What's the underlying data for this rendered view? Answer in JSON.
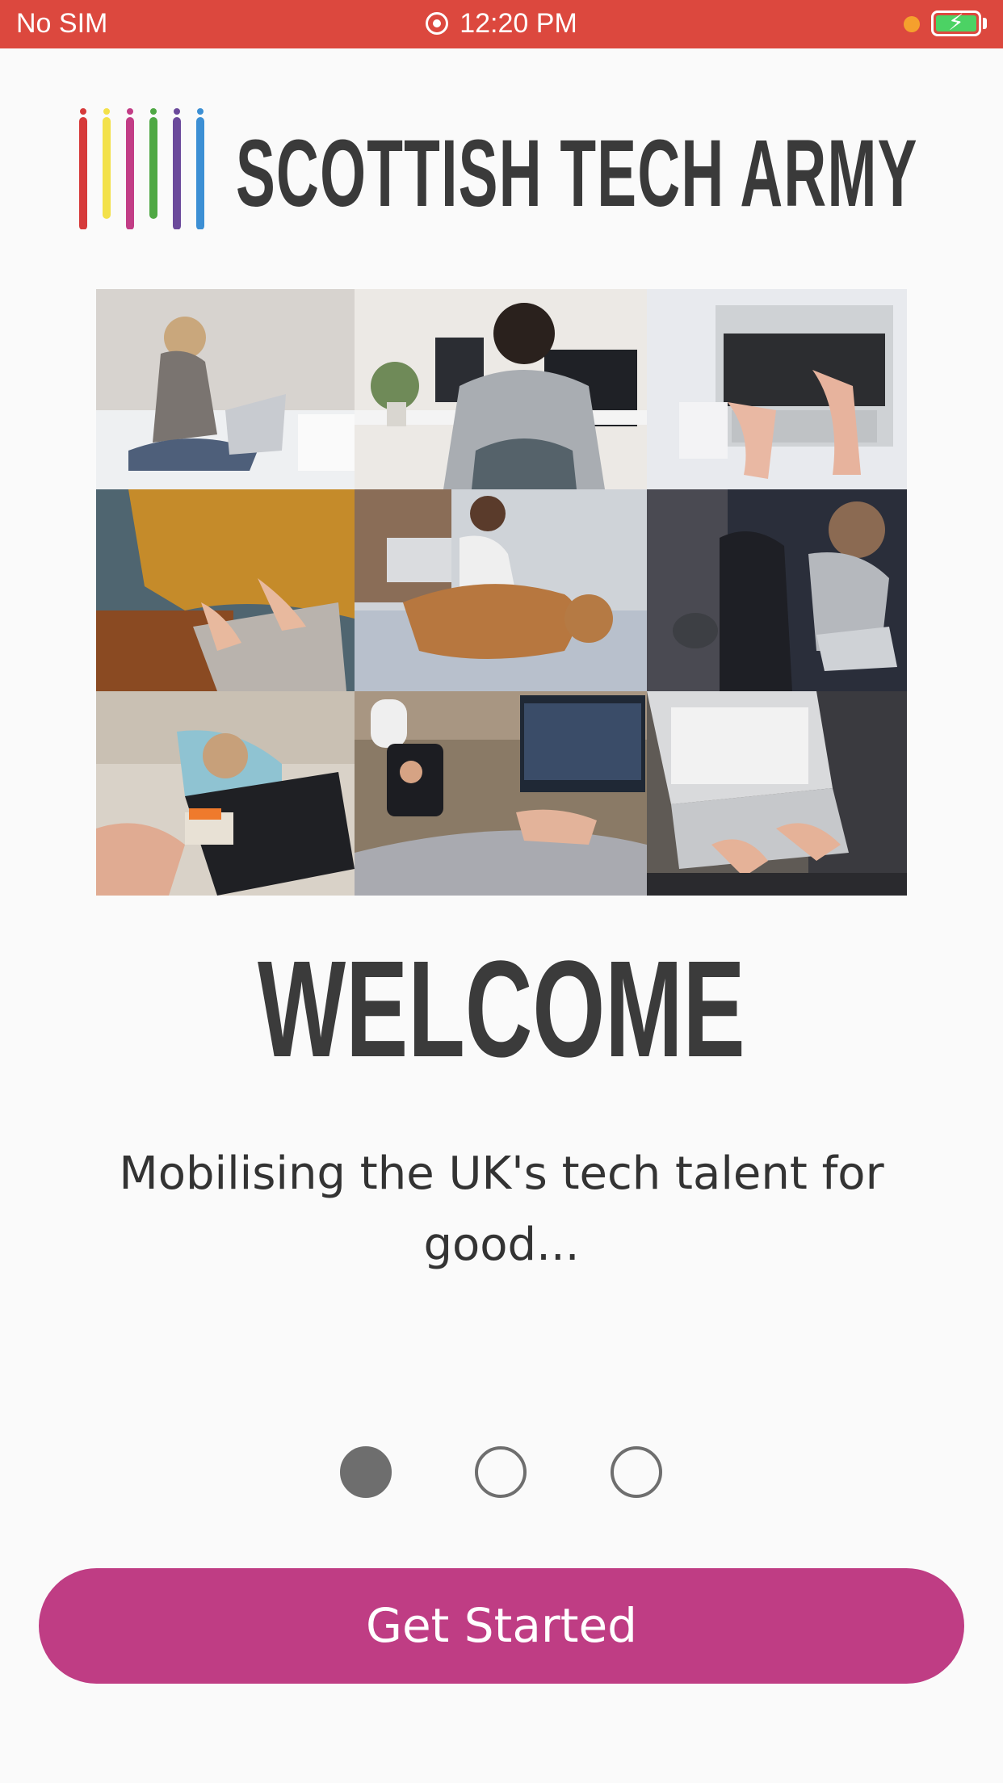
{
  "status_bar": {
    "carrier": "No SIM",
    "time": "12:20 PM",
    "record_icon": "screen-recording-icon",
    "battery_icon": "battery-charging-icon",
    "colors": {
      "background": "#dc483e",
      "battery_fill": "#4cd264",
      "indicator": "#f5a02d"
    }
  },
  "brand": {
    "name": "SCOTTISH TECH ARMY",
    "bar_colors": [
      "#d63a3a",
      "#f3e14a",
      "#c23d86",
      "#4fa844",
      "#6b4a9b",
      "#3c8fd4"
    ]
  },
  "collage": {
    "images": [
      "woman-on-bed-with-laptop",
      "man-at-desk-with-monitor",
      "hands-on-laptop-on-bed",
      "person-in-yellow-sweater-typing",
      "woman-with-laptop-and-dog",
      "woman-with-laptop-in-armchair",
      "person-with-dog-and-laptop",
      "video-call-with-phone-and-laptop",
      "hands-typing-on-laptop"
    ]
  },
  "welcome": {
    "title": "WELCOME",
    "tagline": "Mobilising the UK's tech talent for good..."
  },
  "pager": {
    "total": 3,
    "current": 1
  },
  "actions": {
    "get_started": "Get Started",
    "color": "#bf3d84"
  }
}
